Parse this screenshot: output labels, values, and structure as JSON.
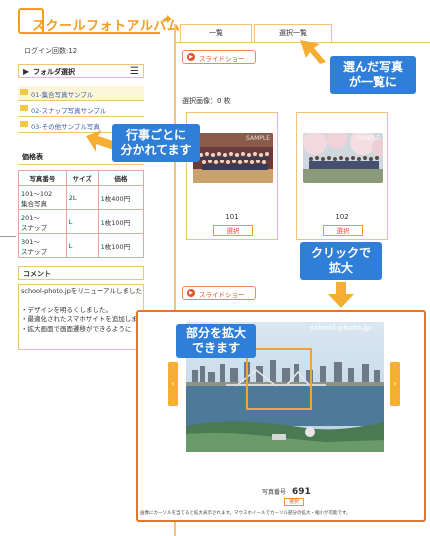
{
  "logo": {
    "text": "スクールフォトアルバム"
  },
  "login": {
    "text": "ログイン回数:12"
  },
  "folder": {
    "header": "フォルダ選択",
    "items": [
      {
        "label": "01-集合写真サンプル"
      },
      {
        "label": "02-スナップ写真サンプル"
      },
      {
        "label": "03-その他サンプル写真"
      }
    ]
  },
  "price": {
    "header": "価格表",
    "columns": [
      "写真番号",
      "サイズ",
      "価格"
    ],
    "rows": [
      {
        "no_line1": "101～102",
        "no_line2": "集合写真",
        "size": "2L",
        "price": "1枚400円"
      },
      {
        "no_line1": "201～",
        "no_line2": "スナップ",
        "size": "L",
        "price": "1枚100円"
      },
      {
        "no_line1": "301～",
        "no_line2": "スナップ",
        "size": "L",
        "price": "1枚100円"
      }
    ]
  },
  "comment": {
    "header": "コメント",
    "lines": [
      "school-photo.jpをリニューアルしました",
      "",
      "・デザインを明るくしました。",
      "・最適化されたスマホサイトを追加しました。",
      "・拡大画面で画面遷移ができるように"
    ]
  },
  "tabs": [
    {
      "label": "一覧"
    },
    {
      "label": "選択一覧"
    }
  ],
  "slideshow": {
    "label": "スライドショー"
  },
  "selected_count": "選択画像：0 枚",
  "photos": [
    {
      "number": "101",
      "select": "選択",
      "watermark": "SAMPLE"
    },
    {
      "number": "102",
      "select": "選択",
      "watermark": "SAMPLE"
    }
  ],
  "callouts": {
    "selected": [
      "選んだ写真",
      "が一覧に"
    ],
    "events": [
      "行事ごとに",
      "分かれてます"
    ],
    "click": [
      "クリックで",
      "拡大"
    ],
    "zoom": [
      "部分を拡大",
      "できます"
    ]
  },
  "zoom": {
    "photo_no_label": "写真番号",
    "photo_no": "691",
    "select": "選択",
    "note": "画像にカーソルを当てると拡大表示されます。マウスホイールでカーソル部分の拡大・縮小が可能です。",
    "watermark": "school-photo.jp",
    "prev_icon": "‹",
    "next_icon": "›"
  },
  "colors": {
    "accent": "#f39b23",
    "callout": "#2f7fd8",
    "panel_border": "#e8742a"
  }
}
